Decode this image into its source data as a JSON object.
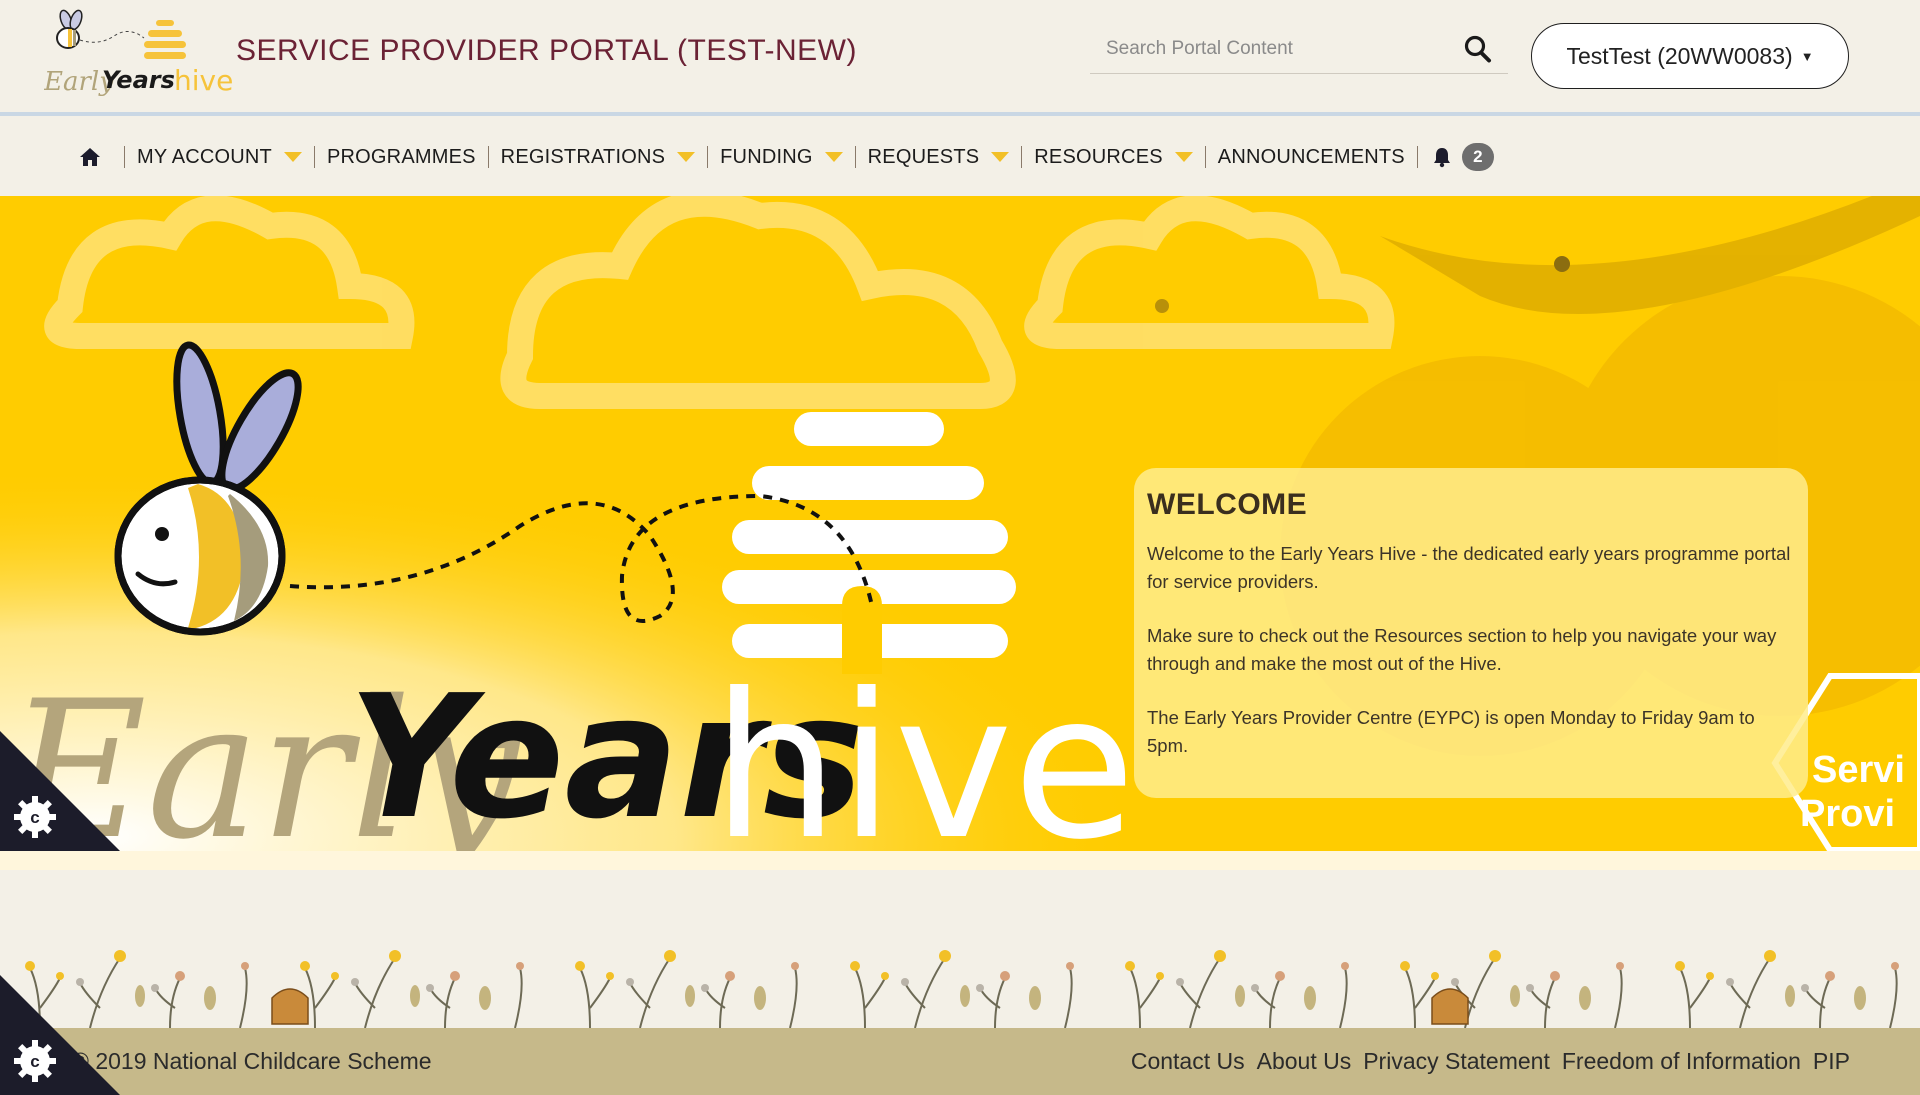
{
  "header": {
    "logo_alt": "Early Years hive",
    "portal_title": "SERVICE PROVIDER PORTAL (TEST-NEW)",
    "search_placeholder": "Search Portal Content",
    "account_label": "TestTest (20WW0083)"
  },
  "nav": {
    "items": [
      {
        "label": "MY ACCOUNT",
        "dropdown": true
      },
      {
        "label": "PROGRAMMES",
        "dropdown": false
      },
      {
        "label": "REGISTRATIONS",
        "dropdown": true
      },
      {
        "label": "FUNDING",
        "dropdown": true
      },
      {
        "label": "REQUESTS",
        "dropdown": true
      },
      {
        "label": "RESOURCES",
        "dropdown": true
      },
      {
        "label": "ANNOUNCEMENTS",
        "dropdown": false
      }
    ],
    "notification_count": "2"
  },
  "hero": {
    "brand_early": "Early",
    "brand_years": "Years",
    "brand_hive": "hive",
    "side_badge_line1": "Servi",
    "side_badge_line2": "Provi"
  },
  "welcome": {
    "title": "WELCOME",
    "p1": "Welcome to the Early Years Hive - the dedicated early years programme portal for service providers.",
    "p2": "Make sure to check out the Resources section to help you navigate your way through and make the most out of the Hive.",
    "p3": "The Early Years Provider Centre (EYPC) is open Monday to Friday 9am to 5pm."
  },
  "footer": {
    "copyright": "© 2019 National Childcare Scheme",
    "links": [
      "Contact Us",
      "About Us",
      "Privacy Statement",
      "Freedom of Information",
      "PIP"
    ]
  },
  "colors": {
    "title_maroon": "#6b2235",
    "hero_yellow": "#ffcc00",
    "nav_caret": "#f2c027",
    "footer_bg": "#c6b98a",
    "page_bg": "#f3f0e7"
  },
  "icons": {
    "home": "home-icon",
    "search": "search-icon",
    "bell": "bell-icon",
    "cookie": "cookie-settings-icon"
  }
}
